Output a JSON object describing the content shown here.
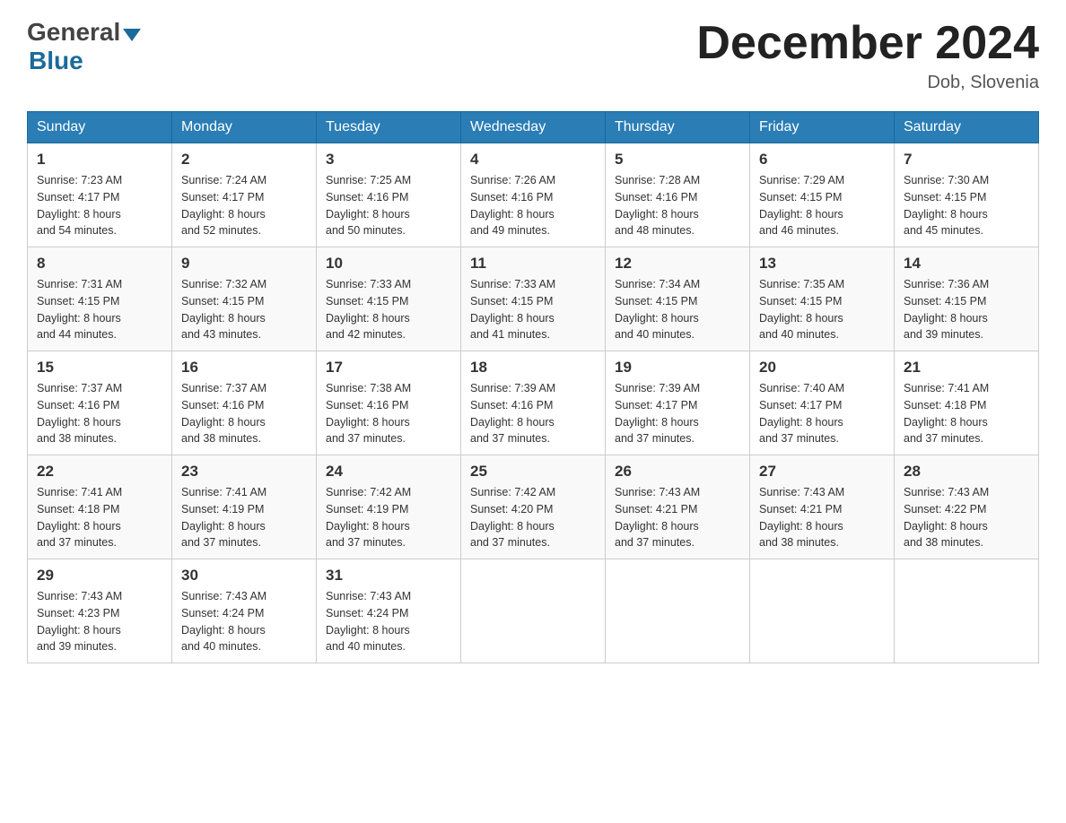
{
  "header": {
    "month_title": "December 2024",
    "location": "Dob, Slovenia"
  },
  "days_of_week": [
    "Sunday",
    "Monday",
    "Tuesday",
    "Wednesday",
    "Thursday",
    "Friday",
    "Saturday"
  ],
  "weeks": [
    [
      {
        "day": "1",
        "sunrise": "7:23 AM",
        "sunset": "4:17 PM",
        "daylight": "8 hours and 54 minutes."
      },
      {
        "day": "2",
        "sunrise": "7:24 AM",
        "sunset": "4:17 PM",
        "daylight": "8 hours and 52 minutes."
      },
      {
        "day": "3",
        "sunrise": "7:25 AM",
        "sunset": "4:16 PM",
        "daylight": "8 hours and 50 minutes."
      },
      {
        "day": "4",
        "sunrise": "7:26 AM",
        "sunset": "4:16 PM",
        "daylight": "8 hours and 49 minutes."
      },
      {
        "day": "5",
        "sunrise": "7:28 AM",
        "sunset": "4:16 PM",
        "daylight": "8 hours and 48 minutes."
      },
      {
        "day": "6",
        "sunrise": "7:29 AM",
        "sunset": "4:15 PM",
        "daylight": "8 hours and 46 minutes."
      },
      {
        "day": "7",
        "sunrise": "7:30 AM",
        "sunset": "4:15 PM",
        "daylight": "8 hours and 45 minutes."
      }
    ],
    [
      {
        "day": "8",
        "sunrise": "7:31 AM",
        "sunset": "4:15 PM",
        "daylight": "8 hours and 44 minutes."
      },
      {
        "day": "9",
        "sunrise": "7:32 AM",
        "sunset": "4:15 PM",
        "daylight": "8 hours and 43 minutes."
      },
      {
        "day": "10",
        "sunrise": "7:33 AM",
        "sunset": "4:15 PM",
        "daylight": "8 hours and 42 minutes."
      },
      {
        "day": "11",
        "sunrise": "7:33 AM",
        "sunset": "4:15 PM",
        "daylight": "8 hours and 41 minutes."
      },
      {
        "day": "12",
        "sunrise": "7:34 AM",
        "sunset": "4:15 PM",
        "daylight": "8 hours and 40 minutes."
      },
      {
        "day": "13",
        "sunrise": "7:35 AM",
        "sunset": "4:15 PM",
        "daylight": "8 hours and 40 minutes."
      },
      {
        "day": "14",
        "sunrise": "7:36 AM",
        "sunset": "4:15 PM",
        "daylight": "8 hours and 39 minutes."
      }
    ],
    [
      {
        "day": "15",
        "sunrise": "7:37 AM",
        "sunset": "4:16 PM",
        "daylight": "8 hours and 38 minutes."
      },
      {
        "day": "16",
        "sunrise": "7:37 AM",
        "sunset": "4:16 PM",
        "daylight": "8 hours and 38 minutes."
      },
      {
        "day": "17",
        "sunrise": "7:38 AM",
        "sunset": "4:16 PM",
        "daylight": "8 hours and 37 minutes."
      },
      {
        "day": "18",
        "sunrise": "7:39 AM",
        "sunset": "4:16 PM",
        "daylight": "8 hours and 37 minutes."
      },
      {
        "day": "19",
        "sunrise": "7:39 AM",
        "sunset": "4:17 PM",
        "daylight": "8 hours and 37 minutes."
      },
      {
        "day": "20",
        "sunrise": "7:40 AM",
        "sunset": "4:17 PM",
        "daylight": "8 hours and 37 minutes."
      },
      {
        "day": "21",
        "sunrise": "7:41 AM",
        "sunset": "4:18 PM",
        "daylight": "8 hours and 37 minutes."
      }
    ],
    [
      {
        "day": "22",
        "sunrise": "7:41 AM",
        "sunset": "4:18 PM",
        "daylight": "8 hours and 37 minutes."
      },
      {
        "day": "23",
        "sunrise": "7:41 AM",
        "sunset": "4:19 PM",
        "daylight": "8 hours and 37 minutes."
      },
      {
        "day": "24",
        "sunrise": "7:42 AM",
        "sunset": "4:19 PM",
        "daylight": "8 hours and 37 minutes."
      },
      {
        "day": "25",
        "sunrise": "7:42 AM",
        "sunset": "4:20 PM",
        "daylight": "8 hours and 37 minutes."
      },
      {
        "day": "26",
        "sunrise": "7:43 AM",
        "sunset": "4:21 PM",
        "daylight": "8 hours and 37 minutes."
      },
      {
        "day": "27",
        "sunrise": "7:43 AM",
        "sunset": "4:21 PM",
        "daylight": "8 hours and 38 minutes."
      },
      {
        "day": "28",
        "sunrise": "7:43 AM",
        "sunset": "4:22 PM",
        "daylight": "8 hours and 38 minutes."
      }
    ],
    [
      {
        "day": "29",
        "sunrise": "7:43 AM",
        "sunset": "4:23 PM",
        "daylight": "8 hours and 39 minutes."
      },
      {
        "day": "30",
        "sunrise": "7:43 AM",
        "sunset": "4:24 PM",
        "daylight": "8 hours and 40 minutes."
      },
      {
        "day": "31",
        "sunrise": "7:43 AM",
        "sunset": "4:24 PM",
        "daylight": "8 hours and 40 minutes."
      },
      null,
      null,
      null,
      null
    ]
  ],
  "labels": {
    "sunrise_prefix": "Sunrise: ",
    "sunset_prefix": "Sunset: ",
    "daylight_prefix": "Daylight: "
  }
}
